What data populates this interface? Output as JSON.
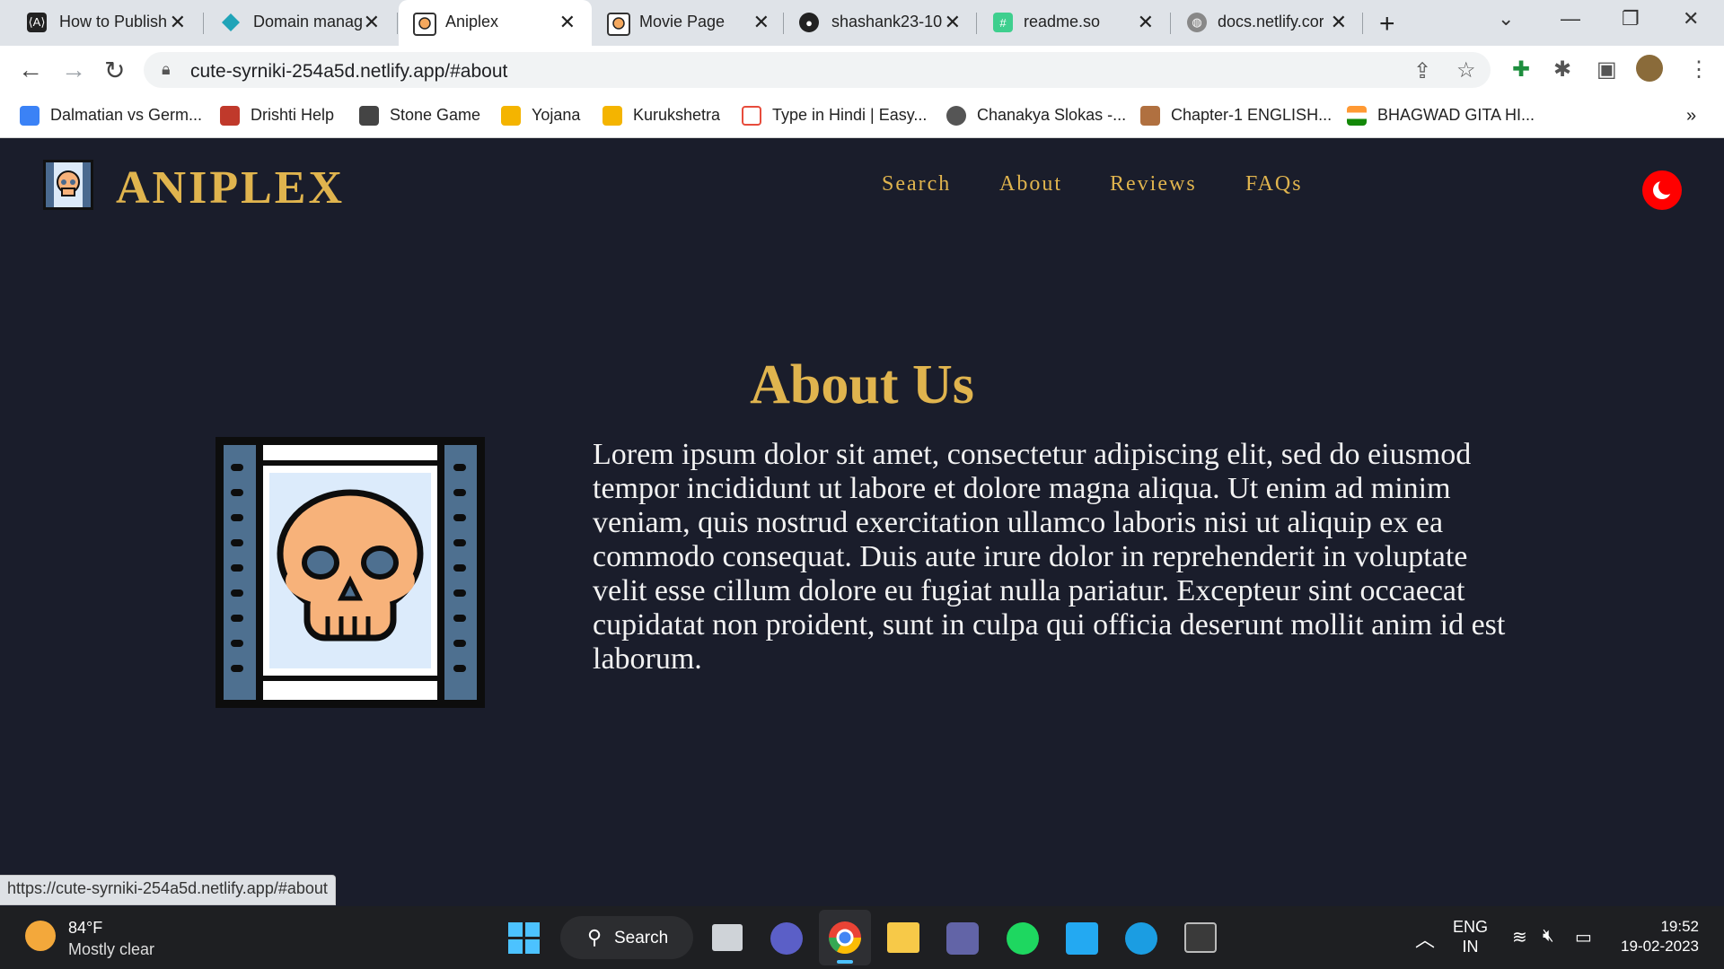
{
  "browser": {
    "tabs": [
      {
        "label": "How to Publish",
        "icon": "codex-icon",
        "color": "#222222"
      },
      {
        "label": "Domain manag",
        "icon": "netlify-diamond-icon",
        "color": "#20a4b8"
      },
      {
        "label": "Aniplex",
        "icon": "skull-film-icon",
        "color": "#555555"
      },
      {
        "label": "Movie Page",
        "icon": "skull-film-icon",
        "color": "#555555"
      },
      {
        "label": "shashank23-10",
        "icon": "github-icon",
        "color": "#222222"
      },
      {
        "label": "readme.so",
        "icon": "hash-icon",
        "color": "#3ecf8e"
      },
      {
        "label": "docs.netlify.cor",
        "icon": "globe-icon",
        "color": "#888888"
      }
    ],
    "active_tab": 2,
    "url": "cute-syrniki-254a5d.netlify.app/#about",
    "bookmarks": [
      {
        "label": "Dalmatian vs Germ...",
        "color": "#3b82f6"
      },
      {
        "label": "Drishti Help",
        "color": "#c0392b"
      },
      {
        "label": "Stone Game",
        "color": "#444444"
      },
      {
        "label": "Yojana",
        "color": "#f4b400"
      },
      {
        "label": "Kurukshetra",
        "color": "#f4b400"
      },
      {
        "label": "Type in Hindi | Easy...",
        "color": "#e74c3c"
      },
      {
        "label": "Chanakya Slokas -...",
        "color": "#555555"
      },
      {
        "label": "Chapter-1 ENGLISH...",
        "color": "#b07040"
      },
      {
        "label": "BHAGWAD GITA HI...",
        "color": "#ff9933"
      }
    ],
    "status_url": "https://cute-syrniki-254a5d.netlify.app/#about"
  },
  "site": {
    "brand": "ANIPLEX",
    "nav": [
      "Search",
      "About",
      "Reviews",
      "FAQs"
    ],
    "about_title": "About Us",
    "about_text": "Lorem ipsum dolor sit amet, consectetur adipiscing elit, sed do eiusmod tempor incididunt ut labore et dolore magna aliqua. Ut enim ad minim veniam, quis nostrud exercitation ullamco laboris nisi ut aliquip ex ea commodo consequat. Duis aute irure dolor in reprehenderit in voluptate velit esse cillum dolore eu fugiat nulla pariatur. Excepteur sint occaecat cupidatat non proident, sunt in culpa qui officia deserunt mollit anim id est laborum.",
    "accent": "#e0b44e",
    "background": "#1a1d2b"
  },
  "taskbar": {
    "temperature": "84°F",
    "weather": "Mostly clear",
    "search_label": "Search",
    "lang": "ENG",
    "region": "IN",
    "time": "19:52",
    "date": "19-02-2023"
  }
}
